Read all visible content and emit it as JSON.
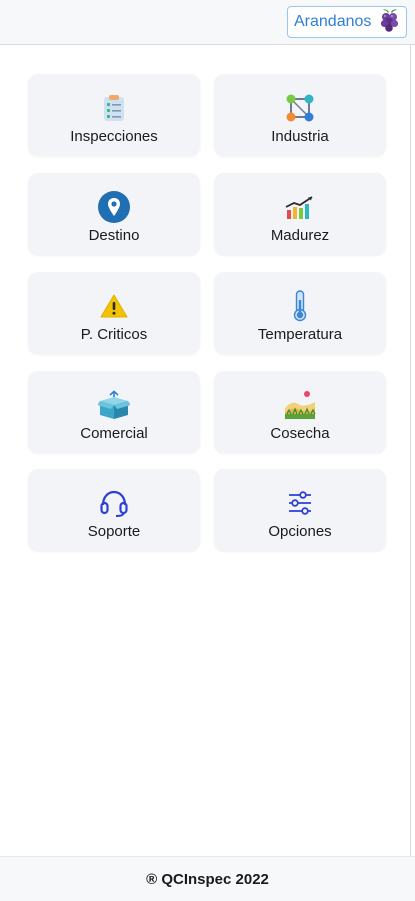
{
  "header": {
    "fruit_selector": {
      "label": "Arandanos",
      "icon": "blueberry-icon"
    }
  },
  "menu": [
    {
      "label": "Inspecciones",
      "icon": "checklist-icon"
    },
    {
      "label": "Industria",
      "icon": "network-icon"
    },
    {
      "label": "Destino",
      "icon": "location-pin-icon"
    },
    {
      "label": "Madurez",
      "icon": "bar-chart-trend-icon"
    },
    {
      "label": "P. Criticos",
      "icon": "warning-icon"
    },
    {
      "label": "Temperatura",
      "icon": "thermometer-icon"
    },
    {
      "label": "Comercial",
      "icon": "box-icon"
    },
    {
      "label": "Cosecha",
      "icon": "field-icon"
    },
    {
      "label": "Soporte",
      "icon": "headset-icon"
    },
    {
      "label": "Opciones",
      "icon": "sliders-icon"
    }
  ],
  "footer": {
    "text": "® QCInspec 2022"
  }
}
